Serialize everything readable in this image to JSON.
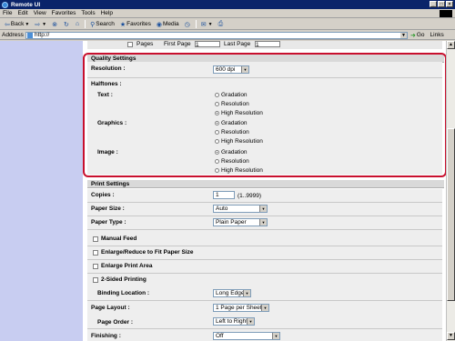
{
  "window": {
    "title": "Remote UI",
    "min": "_",
    "max": "□",
    "close": "×"
  },
  "menu": [
    "File",
    "Edit",
    "View",
    "Favorites",
    "Tools",
    "Help"
  ],
  "toolbar": {
    "back": "Back",
    "search": "Search",
    "favorites": "Favorites",
    "media": "Media"
  },
  "address": {
    "label": "Address",
    "value": "http://",
    "go": "Go",
    "links": "Links"
  },
  "top_strip": {
    "pages_label": "Pages",
    "first_page_label": "First Page",
    "first_page_value": "1",
    "last_page_label": "Last Page",
    "last_page_value": "1"
  },
  "quality": {
    "title": "Quality Settings",
    "resolution_label": "Resolution :",
    "resolution_value": "600 dpi",
    "halftones_label": "Halftones :",
    "text_label": "Text :",
    "text_options": [
      {
        "label": "Gradation",
        "checked": false
      },
      {
        "label": "Resolution",
        "checked": false
      },
      {
        "label": "High Resolution",
        "checked": true
      }
    ],
    "graphics_label": "Graphics :",
    "graphics_options": [
      {
        "label": "Gradation",
        "checked": true
      },
      {
        "label": "Resolution",
        "checked": false
      },
      {
        "label": "High Resolution",
        "checked": false
      }
    ],
    "image_label": "Image :",
    "image_options": [
      {
        "label": "Gradation",
        "checked": true
      },
      {
        "label": "Resolution",
        "checked": false
      },
      {
        "label": "High Resolution",
        "checked": false
      }
    ]
  },
  "print": {
    "title": "Print Settings",
    "copies_label": "Copies :",
    "copies_value": "1",
    "copies_range": "(1..9999)",
    "paper_size_label": "Paper Size :",
    "paper_size_value": "Auto",
    "paper_type_label": "Paper Type :",
    "paper_type_value": "Plain Paper",
    "manual_feed": "Manual Feed",
    "enlarge_reduce": "Enlarge/Reduce to Fit Paper Size",
    "enlarge_area": "Enlarge Print Area",
    "two_sided": "2-Sided Printing",
    "binding_label": "Binding Location :",
    "binding_value": "Long Edge",
    "page_layout_label": "Page Layout :",
    "page_layout_value": "1 Page per Sheet",
    "page_order_label": "Page Order :",
    "page_order_value": "Left to Right",
    "finishing_label": "Finishing :",
    "finishing_value": "Off"
  }
}
